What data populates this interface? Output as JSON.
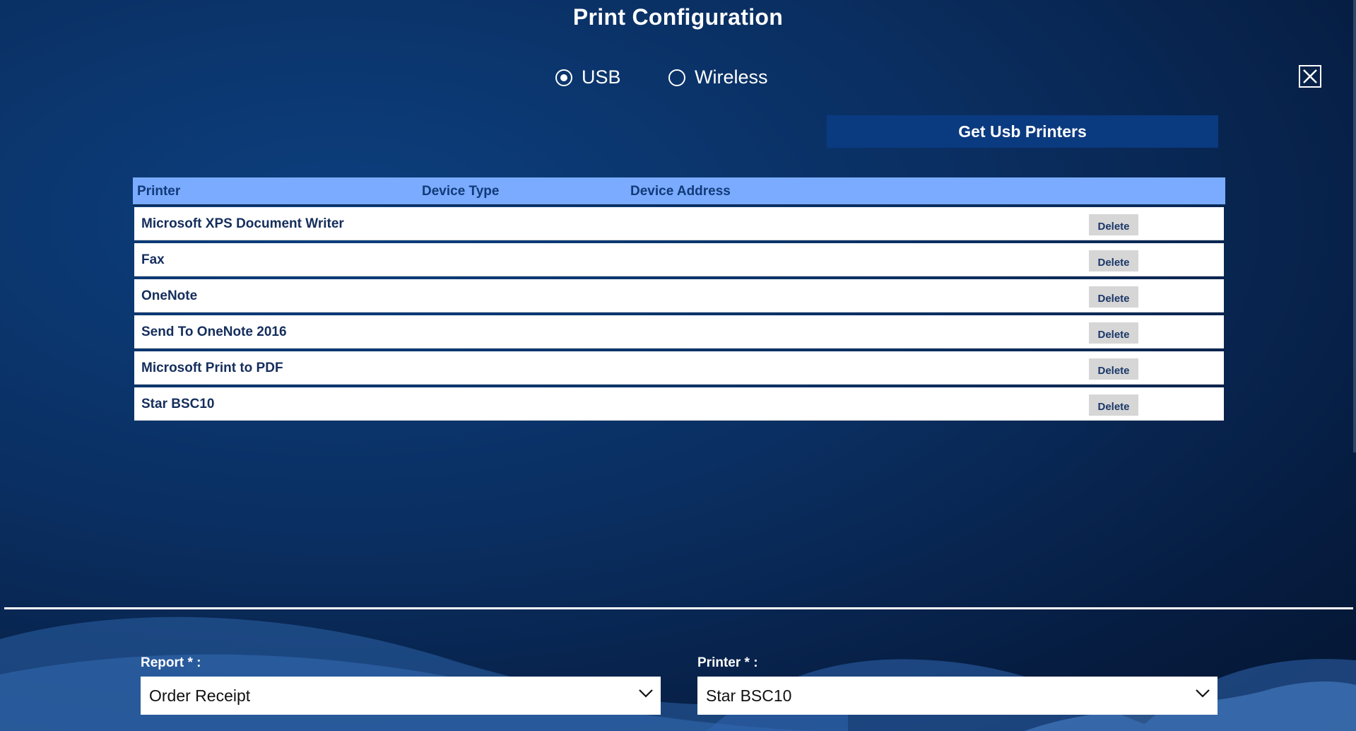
{
  "title": "Print Configuration",
  "connection": {
    "options": [
      {
        "label": "USB",
        "checked": true
      },
      {
        "label": "Wireless",
        "checked": false
      }
    ]
  },
  "get_button_label": "Get Usb Printers",
  "table": {
    "headers": [
      "Printer",
      "Device Type",
      "Device Address"
    ],
    "rows": [
      {
        "printer": "Microsoft XPS Document Writer",
        "device_type": "",
        "device_address": "",
        "action": "Delete"
      },
      {
        "printer": "Fax",
        "device_type": "",
        "device_address": "",
        "action": "Delete"
      },
      {
        "printer": "OneNote",
        "device_type": "",
        "device_address": "",
        "action": "Delete"
      },
      {
        "printer": "Send To OneNote 2016",
        "device_type": "",
        "device_address": "",
        "action": "Delete"
      },
      {
        "printer": "Microsoft Print to PDF",
        "device_type": "",
        "device_address": "",
        "action": "Delete"
      },
      {
        "printer": "Star BSC10",
        "device_type": "",
        "device_address": "",
        "action": "Delete"
      }
    ]
  },
  "report": {
    "label": "Report * :",
    "value": "Order Receipt"
  },
  "printer_select": {
    "label": "Printer * :",
    "value": "Star BSC10"
  },
  "icons": {
    "close": "close-icon",
    "radio": "radio-icon",
    "dropdown": "chevron-down-icon"
  },
  "colors": {
    "background": "#0a2e60",
    "header_row": "#7aabff",
    "button": "#0a3a80",
    "delete_button": "#d6d6d6",
    "row_text": "#152e5c"
  }
}
